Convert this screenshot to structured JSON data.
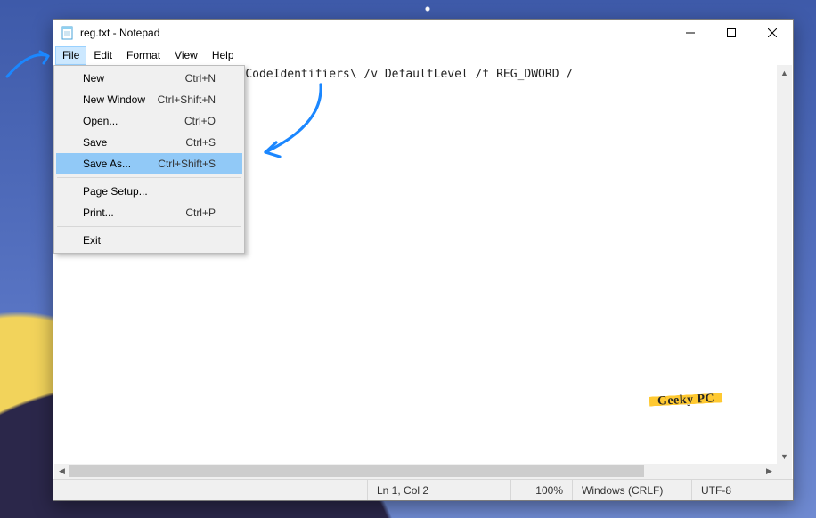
{
  "title": "reg.txt - Notepad",
  "menubar": [
    "File",
    "Edit",
    "Format",
    "View",
    "Help"
  ],
  "menubar_open_index": 0,
  "content_line": "es\\Microsoft\\Windows\\Safer\\CodeIdentifiers\\ /v DefaultLevel /t REG_DWORD /",
  "statusbar": {
    "position": "Ln 1, Col 2",
    "zoom": "100%",
    "line_ending": "Windows (CRLF)",
    "encoding": "UTF-8"
  },
  "file_menu": [
    {
      "label": "New",
      "shortcut": "Ctrl+N",
      "hl": false
    },
    {
      "label": "New Window",
      "shortcut": "Ctrl+Shift+N",
      "hl": false
    },
    {
      "label": "Open...",
      "shortcut": "Ctrl+O",
      "hl": false
    },
    {
      "label": "Save",
      "shortcut": "Ctrl+S",
      "hl": false
    },
    {
      "label": "Save As...",
      "shortcut": "Ctrl+Shift+S",
      "hl": true
    },
    {
      "sep": true
    },
    {
      "label": "Page Setup...",
      "shortcut": "",
      "hl": false
    },
    {
      "label": "Print...",
      "shortcut": "Ctrl+P",
      "hl": false
    },
    {
      "sep": true
    },
    {
      "label": "Exit",
      "shortcut": "",
      "hl": false
    }
  ],
  "watermark": "Geeky PC",
  "annotation_color": "#1b87ff"
}
